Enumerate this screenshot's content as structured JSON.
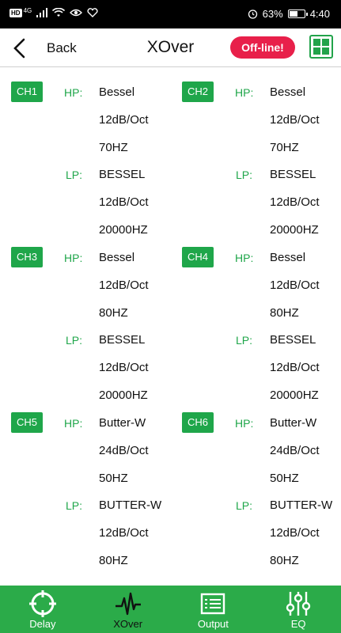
{
  "status_bar": {
    "network_badge": "HD",
    "signal_label": "4G",
    "battery_percent": "63%",
    "battery_level": 0.63,
    "time": "4:40"
  },
  "header": {
    "back_label": "Back",
    "title": "XOver",
    "offline_label": "Off-line!"
  },
  "labels": {
    "hp": "HP:",
    "lp": "LP:"
  },
  "channels": [
    {
      "id": "CH1",
      "hp": {
        "type": "Bessel",
        "slope": "12dB/Oct",
        "freq": "70HZ"
      },
      "lp": {
        "type": "BESSEL",
        "slope": "12dB/Oct",
        "freq": "20000HZ"
      }
    },
    {
      "id": "CH2",
      "hp": {
        "type": "Bessel",
        "slope": "12dB/Oct",
        "freq": "70HZ"
      },
      "lp": {
        "type": "BESSEL",
        "slope": "12dB/Oct",
        "freq": "20000HZ"
      }
    },
    {
      "id": "CH3",
      "hp": {
        "type": "Bessel",
        "slope": "12dB/Oct",
        "freq": "80HZ"
      },
      "lp": {
        "type": "BESSEL",
        "slope": "12dB/Oct",
        "freq": "20000HZ"
      }
    },
    {
      "id": "CH4",
      "hp": {
        "type": "Bessel",
        "slope": "12dB/Oct",
        "freq": "80HZ"
      },
      "lp": {
        "type": "BESSEL",
        "slope": "12dB/Oct",
        "freq": "20000HZ"
      }
    },
    {
      "id": "CH5",
      "hp": {
        "type": "Butter-W",
        "slope": "24dB/Oct",
        "freq": "50HZ"
      },
      "lp": {
        "type": "BUTTER-W",
        "slope": "12dB/Oct",
        "freq": "80HZ"
      }
    },
    {
      "id": "CH6",
      "hp": {
        "type": "Butter-W",
        "slope": "24dB/Oct",
        "freq": "50HZ"
      },
      "lp": {
        "type": "BUTTER-W",
        "slope": "12dB/Oct",
        "freq": "80HZ"
      }
    }
  ],
  "bottom_nav": [
    {
      "label": "Delay",
      "icon": "target-icon",
      "active": false
    },
    {
      "label": "XOver",
      "icon": "waveform-icon",
      "active": true
    },
    {
      "label": "Output",
      "icon": "list-icon",
      "active": false
    },
    {
      "label": "EQ",
      "icon": "sliders-icon",
      "active": false
    }
  ],
  "colors": {
    "accent": "#1fa64a",
    "nav_bg": "#2bab49",
    "offline": "#e8204a"
  }
}
